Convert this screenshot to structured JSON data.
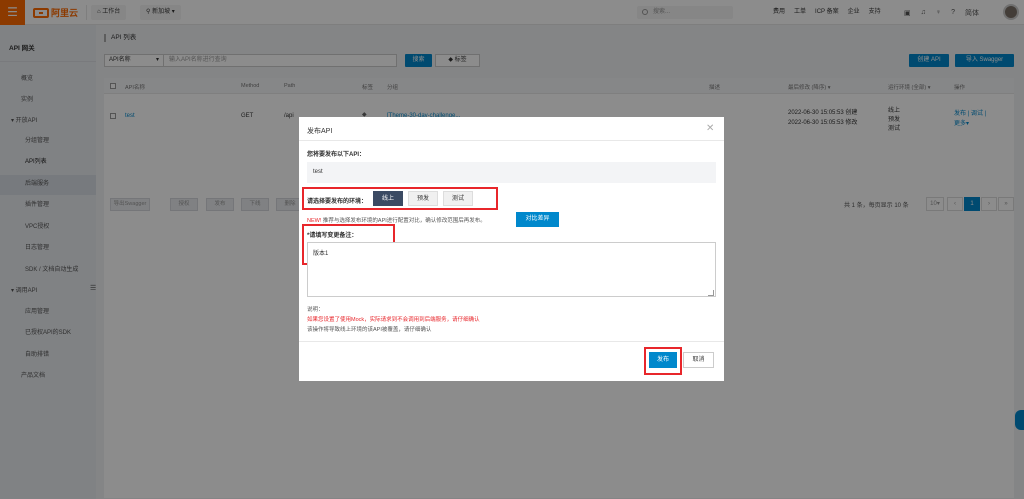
{
  "topbar": {
    "menu_icon": "☰",
    "logo_text": "阿里云",
    "workbench": "工作台",
    "region": "新加坡",
    "search_placeholder": "搜索...",
    "links": [
      "费用",
      "工单",
      "ICP 备案",
      "企业",
      "支持"
    ],
    "language": "简体"
  },
  "sidebar": {
    "title": "API 网关",
    "items": [
      {
        "label": "概览"
      },
      {
        "label": "实例"
      },
      {
        "label": "▾ 开放API"
      },
      {
        "label": "分组管理"
      },
      {
        "label": "API列表"
      },
      {
        "label": "后端服务"
      },
      {
        "label": "插件管理"
      },
      {
        "label": "VPC授权"
      },
      {
        "label": "日志管理"
      },
      {
        "label": "SDK / 文档自动生成"
      },
      {
        "label": "▾ 调用API"
      },
      {
        "label": "应用管理"
      },
      {
        "label": "已授权API的SDK"
      },
      {
        "label": "自助排错"
      },
      {
        "label": "产品文档"
      }
    ]
  },
  "main": {
    "page_title": "API 列表",
    "filter_select": "API名称",
    "filter_placeholder": "输入API名称进行查询",
    "search_btn": "搜索",
    "tag_btn": "标签",
    "create_btn": "创建 API",
    "import_btn": "导入 Swagger",
    "columns": [
      "API名称",
      "Method",
      "Path",
      "标签",
      "分组",
      "描述",
      "最后修改 (降序) ▾",
      "运行环境 (全部) ▾",
      "操作"
    ],
    "row": {
      "name": "test",
      "method": "GET",
      "path": "/api",
      "group": "[Theme-30-day-challenge...",
      "modified": "2022-06-30 15:05:53 创建",
      "modified2": "2022-06-30 15:05:53 修改",
      "env1": "线上",
      "env2": "预发",
      "env3": "测试",
      "op1": "发布 | 调试 |",
      "op2": "更多▾"
    },
    "bulk_buttons": [
      "导出Swagger",
      "授权",
      "发布",
      "下线",
      "删除"
    ],
    "pager_text": "共 1 条，每页显示 10 条",
    "page_size": "10",
    "page_current": "1"
  },
  "modal": {
    "title": "发布API",
    "close": "✕",
    "api_label": "您将要发布以下API：",
    "api_name": "test",
    "env_label": "请选择要发布的环境：",
    "env_options": [
      "线上",
      "预发",
      "测试"
    ],
    "notice_new": "NEW!",
    "notice_text": "推荐与选择发布环境的API进行配置对比，确认修改范围后再发布。",
    "compare_btn": "对比差异",
    "remark_label": "*请填写变更备注：",
    "remark_value": "版本1",
    "note_title": "说明：",
    "note_red": "如果您设置了使用Mock，实际请求到不会调用到后端服务，请仔细确认",
    "note_gray": "该操作将导致线上环境的该API被覆盖，请仔细确认",
    "publish_btn": "发布",
    "cancel_btn": "取消"
  },
  "colors": {
    "brand": "#ff6a00",
    "primary": "#0088cc",
    "highlight": "#e8262b",
    "selected_env": "#3b4a63"
  }
}
